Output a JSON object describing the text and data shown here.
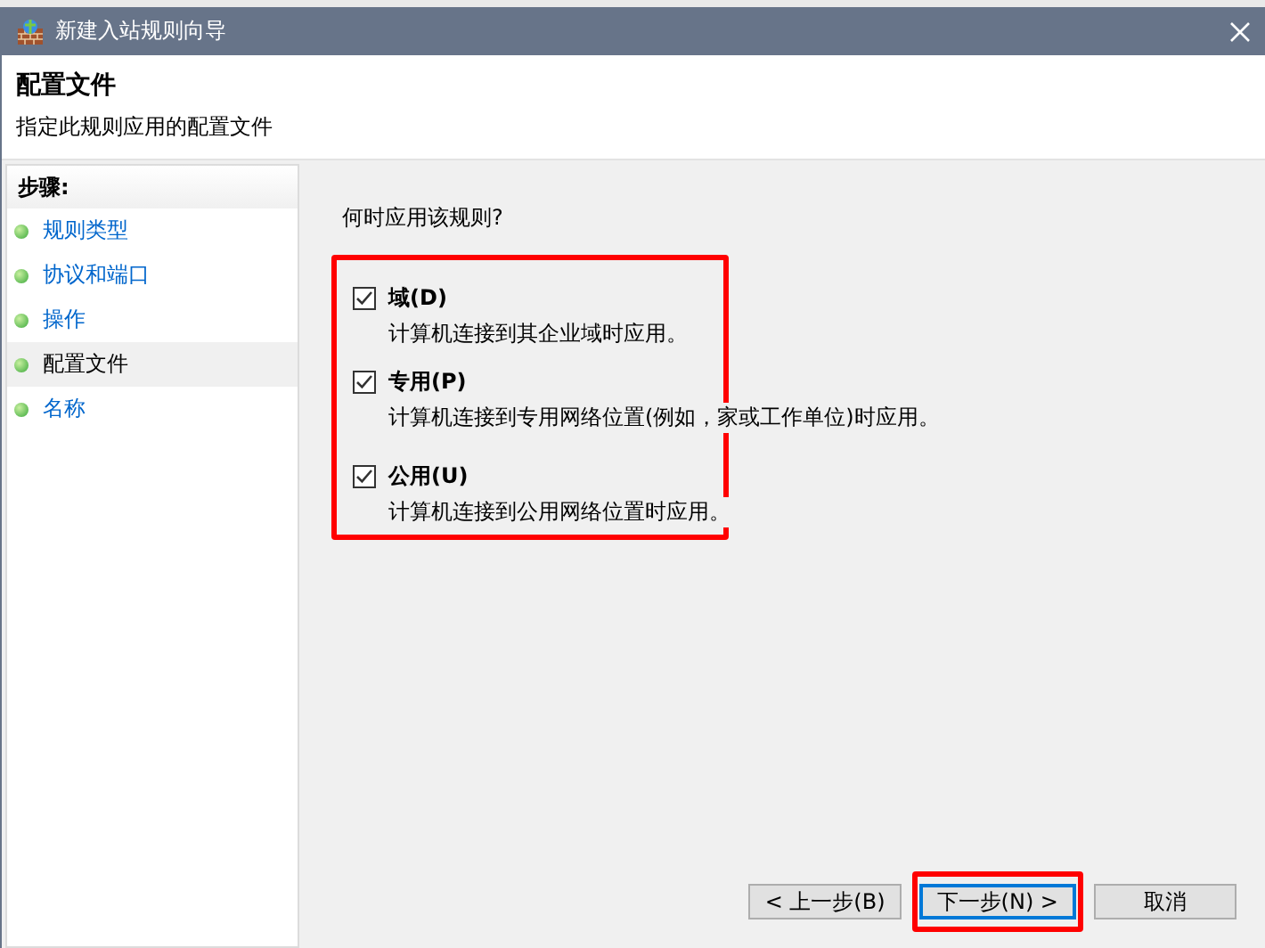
{
  "window": {
    "title": "新建入站规则向导"
  },
  "header": {
    "title": "配置文件",
    "subtitle": "指定此规则应用的配置文件"
  },
  "sidebar": {
    "heading": "步骤:",
    "items": [
      {
        "label": "规则类型",
        "selected": false
      },
      {
        "label": "协议和端口",
        "selected": false
      },
      {
        "label": "操作",
        "selected": false
      },
      {
        "label": "配置文件",
        "selected": true
      },
      {
        "label": "名称",
        "selected": false
      }
    ]
  },
  "question": "何时应用该规则?",
  "options": [
    {
      "label": "域(D)",
      "description": "计算机连接到其企业域时应用。",
      "checked": true
    },
    {
      "label": "专用(P)",
      "description": "计算机连接到专用网络位置(例如，家或工作单位)时应用。",
      "checked": true
    },
    {
      "label": "公用(U)",
      "description": "计算机连接到公用网络位置时应用。",
      "checked": true
    }
  ],
  "buttons": [
    {
      "label": "< 上一步(B)",
      "default": false
    },
    {
      "label": "下一步(N) >",
      "default": true
    },
    {
      "label": "取消",
      "default": false
    }
  ]
}
